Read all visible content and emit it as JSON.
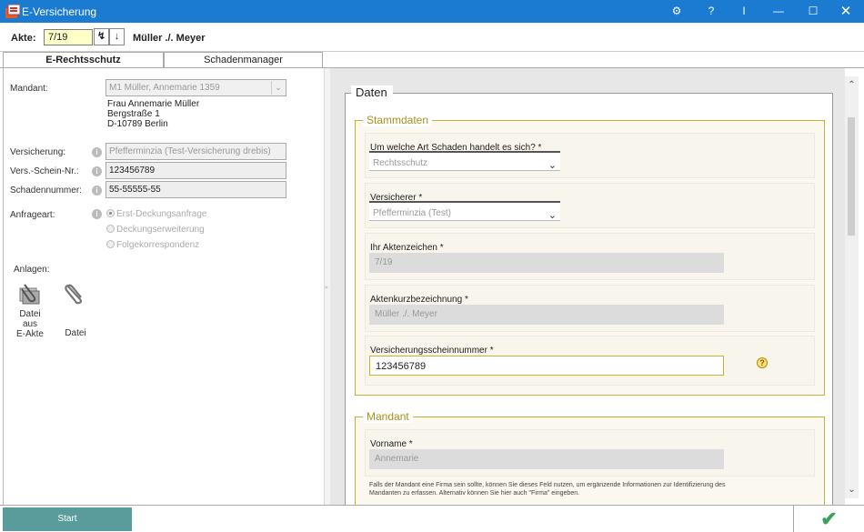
{
  "window": {
    "title": "E-Versicherung",
    "buttons": [
      "settings-icon",
      "help",
      "info",
      "minimize",
      "maximize",
      "close"
    ],
    "help_label": "?",
    "info_label": "I"
  },
  "akte": {
    "label": "Akte:",
    "value": "7/19",
    "name": "Müller ./. Meyer"
  },
  "tabs": [
    {
      "label": "E-Rechtsschutz",
      "active": true
    },
    {
      "label": "Schadenmanager",
      "active": false
    }
  ],
  "left": {
    "mandant_label": "Mandant:",
    "mandant_value": "M1 Müller, Annemarie 1359",
    "address": [
      "Frau Annemarie Müller",
      "Bergstraße 1",
      "D-10789 Berlin"
    ],
    "versicherung_label": "Versicherung:",
    "versicherung_value": "Pfefferminzia (Test-Versicherung drebis)",
    "schein_label": "Vers.-Schein-Nr.:",
    "schein_value": "123456789",
    "schaden_label": "Schadennummer:",
    "schaden_value": "55-55555-55",
    "anfrageart_label": "Anfrageart:",
    "anfrageart_options": [
      "Erst-Deckungsanfrage",
      "Deckungserweiterung",
      "Folgekorrespondenz"
    ],
    "anlagen_label": "Anlagen:",
    "anlage1": [
      "Datei",
      "aus",
      "E-Akte"
    ],
    "anlage2": "Datei"
  },
  "right": {
    "daten_title": "Daten",
    "stammdaten_title": "Stammdaten",
    "schaden_label": "Um welche Art Schaden handelt es sich? *",
    "schaden_value": "Rechtsschutz",
    "versicherer_label": "Versicherer *",
    "versicherer_value": "Pfefferminzia (Test)",
    "aktenzeichen_label": "Ihr Aktenzeichen *",
    "aktenzeichen_value": "7/19",
    "kurzbez_label": "Aktenkurzbezeichnung *",
    "kurzbez_value": "Müller ./. Meyer",
    "vsn_label": "Versicherungsscheinnummer *",
    "vsn_value": "123456789",
    "mandant_title": "Mandant",
    "vorname_label": "Vorname *",
    "vorname_value": "Annemarie",
    "hint": "Falls der Mandant eine Firma sein sollte, können Sie dieses Feld nutzen, um ergänzende Informationen zur Identifizierung des Mandanten zu erfassen. Alternativ können Sie hier auch \"Firma\" eingeben."
  },
  "bottom": {
    "start_label": "Start"
  },
  "colors": {
    "titlebar": "#1a7bd1",
    "accent_gold": "#c8b030",
    "start_button": "#5a9b9b",
    "confirm_check": "#3aa35a"
  }
}
